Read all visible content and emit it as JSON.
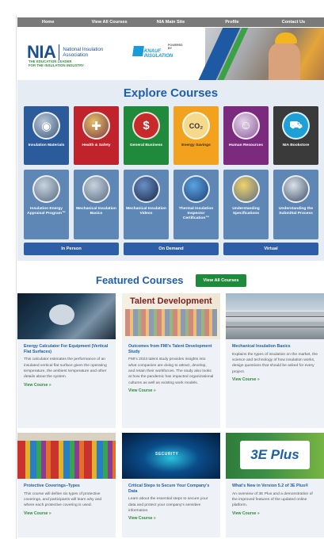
{
  "nav": {
    "items": [
      "Home",
      "View All Courses",
      "NIA Main Site",
      "Profile",
      "Contact Us"
    ]
  },
  "hero": {
    "logo_letters": "NIA",
    "logo_name": "National Insulation Association",
    "tagline_line1": "THE EDUCATION LEADER",
    "tagline_line2": "FOR THE INSULATION INDUSTRY",
    "powered_by": "POWERED BY",
    "sponsor": "KNAUF INSULATION"
  },
  "explore": {
    "title": "Explore Courses",
    "row1": [
      {
        "label": "Insulation Materials",
        "color": "#2c5b9c",
        "icon": "insulation-materials-icon",
        "glyph": "◉"
      },
      {
        "label": "Health & Safety",
        "color": "#c0232b",
        "icon": "health-safety-icon",
        "glyph": "✚"
      },
      {
        "label": "General Business",
        "color": "#1f8a3b",
        "icon": "dollar-icon",
        "glyph": "$"
      },
      {
        "label": "Energy Savings",
        "color": "#f3a21d",
        "icon": "co2-icon",
        "glyph": "CO₂"
      },
      {
        "label": "Human Resources",
        "color": "#7b2a7e",
        "icon": "people-icon",
        "glyph": "☺"
      },
      {
        "label": "NIA Bookstore",
        "color": "#3a3a3a",
        "icon": "cart-icon",
        "glyph": "🛒"
      }
    ],
    "row2": [
      {
        "label": "Insulation Energy Appraisal Program™",
        "icon": "appraisal-icon"
      },
      {
        "label": "Mechanical Insulation Basics",
        "icon": "pipe-icon"
      },
      {
        "label": "Mechanical Insulation Videos",
        "icon": "video-icon"
      },
      {
        "label": "Thermal Insulation Inspector Certification™",
        "icon": "certification-icon"
      },
      {
        "label": "Understanding Specifications",
        "icon": "specifications-icon"
      },
      {
        "label": "Understanding the Submittal Process",
        "icon": "submittal-icon"
      }
    ],
    "buttons": [
      "In Person",
      "On Demand",
      "Virtual"
    ]
  },
  "featured": {
    "title": "Featured Courses",
    "view_all": "View All Courses",
    "cards": [
      {
        "title": "Energy Calculator For Equipment (Vertical Flat Surfaces)",
        "desc": "This calculator estimates the performance of an insulated vertical flat surface given the operating temperature, the ambient temperature and other details about the system.",
        "link": "View Course »"
      },
      {
        "title": "Outcomes from FMI's Talent Development Study",
        "desc": "FMI's 2023 talent study provides insights into what companies are doing to attract, develop, and retain their workforces. The study also looks at how the pandemic has impacted organizational cultures as well as existing work models.",
        "link": "View Course »"
      },
      {
        "title": "Mechanical Insulation Basics",
        "desc": "Explains the types of insulation on the market, the science and technology of how insulation works, design questions that should be asked for every project.",
        "link": "View Course »"
      },
      {
        "title": "Protective Coverings–Types",
        "desc": "This course will define six types of protective coverings, and participants will learn why and where each protective covering is used.",
        "link": "View Course »"
      },
      {
        "title": "Critical Steps to Secure Your Company's Data",
        "desc": "Learn about the essential steps to secure your data and protect your company's sensitive information.",
        "link": "View Course »"
      },
      {
        "title": "What's New in Version 5.2 of 3E Plus®",
        "desc": "An overview of 3E Plus and a demonstration of the improved features of the updated online platform.",
        "link": "View Course »"
      }
    ],
    "thumb_texts": {
      "talent": "Talent Development",
      "security": "SECURITY",
      "threeE": "3E Plus"
    }
  }
}
